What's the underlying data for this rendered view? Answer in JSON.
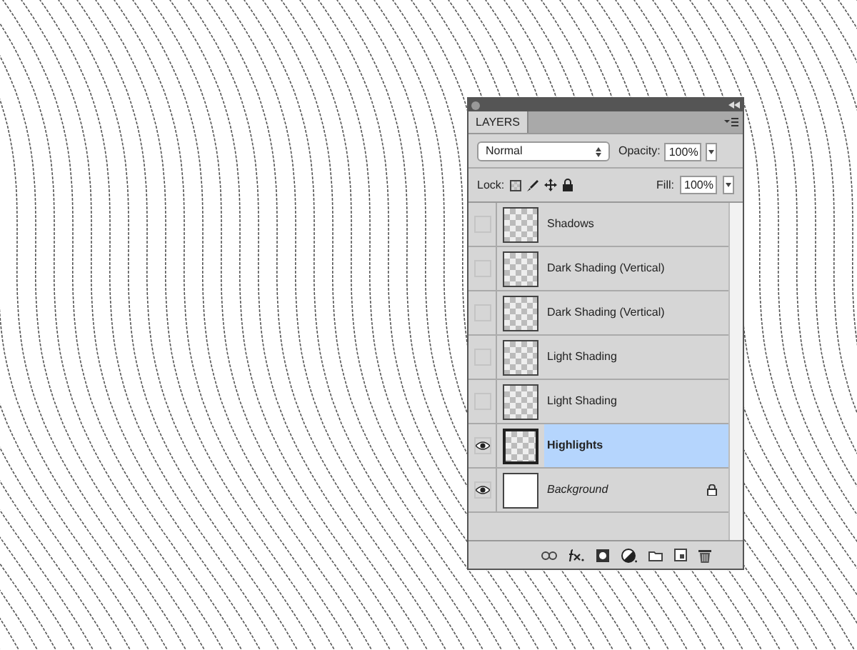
{
  "panel": {
    "tab": "LAYERS",
    "blend_mode": "Normal",
    "opacity_label": "Opacity:",
    "opacity": "100%",
    "lock_label": "Lock:",
    "fill_label": "Fill:",
    "fill": "100%"
  },
  "layers": [
    {
      "name": "Shadows",
      "kind": "layer",
      "visible": false,
      "selected": false,
      "locked": false
    },
    {
      "name": "Dark Shading (Vertical)",
      "kind": "layer",
      "visible": false,
      "selected": false,
      "locked": false
    },
    {
      "name": "Dark Shading (Vertical)",
      "kind": "layer",
      "visible": false,
      "selected": false,
      "locked": false
    },
    {
      "name": "Light Shading",
      "kind": "layer",
      "visible": false,
      "selected": false,
      "locked": false
    },
    {
      "name": "Light Shading",
      "kind": "layer",
      "visible": false,
      "selected": false,
      "locked": false
    },
    {
      "name": "Highlights",
      "kind": "layer",
      "visible": true,
      "selected": true,
      "locked": false
    },
    {
      "name": "Background",
      "kind": "background",
      "visible": true,
      "selected": false,
      "locked": true
    }
  ]
}
